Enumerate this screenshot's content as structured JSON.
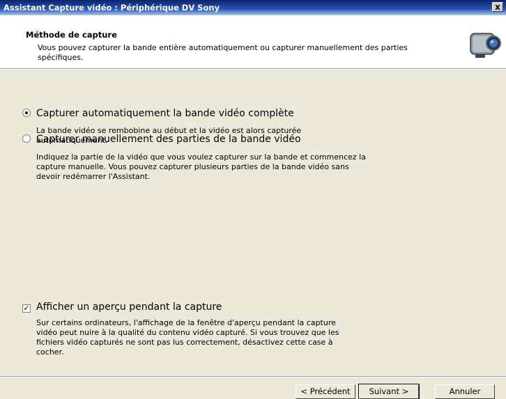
{
  "window": {
    "title": "Assistant Capture vidéo : Périphérique DV Sony",
    "close_label": "x"
  },
  "header": {
    "title": "Méthode de capture",
    "description": "Vous pouvez capturer la bande entière automatiquement ou capturer manuellement des parties spécifiques.",
    "icon": "camcorder-icon"
  },
  "options": {
    "auto": {
      "label": "Capturer automatiquement la bande vidéo complète",
      "description": "La bande vidéo se rembobine au début et la vidéo est alors capturée automatiquement.",
      "selected": true
    },
    "manual": {
      "label": "Capturer manuellement des parties de la bande vidéo",
      "description": "Indiquez la partie de la vidéo que vous voulez capturer sur la bande et commencez la capture manuelle. Vous pouvez capturer plusieurs parties de la bande vidéo sans devoir redémarrer l'Assistant.",
      "selected": false
    },
    "preview": {
      "label": "Afficher un aperçu pendant la capture",
      "description": "Sur certains ordinateurs, l'affichage de la fenêtre d'aperçu pendant la capture vidéo peut nuire à la qualité du contenu vidéo capturé. Si vous trouvez que les fichiers vidéo capturés ne sont pas lus correctement, désactivez cette case à cocher.",
      "checked": true,
      "check_mark": "✓"
    }
  },
  "buttons": {
    "back": "< Précédent",
    "next": "Suivant >",
    "cancel": "Annuler"
  }
}
